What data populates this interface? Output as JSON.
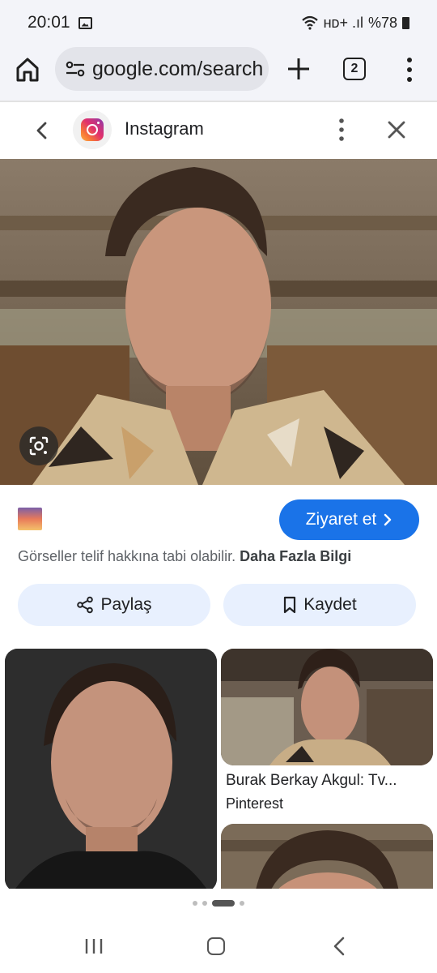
{
  "status_bar": {
    "time": "20:01",
    "indicators": "ʜᴅ+ .ıl",
    "battery": "%78"
  },
  "browser": {
    "url": "google.com/search",
    "tab_count": "2"
  },
  "panel": {
    "source_name": "Instagram"
  },
  "result": {
    "visit_label": "Ziyaret et",
    "copyright_text": "Görseller telif hakkına tabi olabilir.",
    "learn_more": "Daha Fazla Bilgi",
    "share_label": "Paylaş",
    "save_label": "Kaydet"
  },
  "related": {
    "items": [
      {
        "title": "Burak Berkay Akgul: Tv...",
        "source": "Pinterest"
      }
    ]
  },
  "colors": {
    "accent": "#1a73e8",
    "chip_bg": "#e8f0fe",
    "bar_bg": "#f3f4f9"
  }
}
